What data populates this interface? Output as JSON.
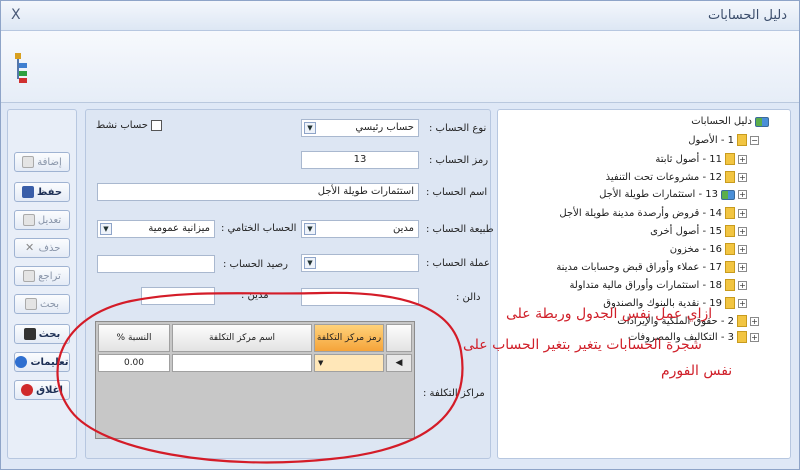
{
  "window": {
    "title": "دليل الحسابات",
    "close": "X"
  },
  "toolbar": {
    "buttons": [
      {
        "label": "إضافة",
        "active": false
      },
      {
        "label": "حفظ",
        "active": true
      },
      {
        "label": "تعديل",
        "active": false
      },
      {
        "label": "حذف",
        "active": false
      },
      {
        "label": "تراجع",
        "active": false
      },
      {
        "label": "بحث",
        "active": false
      },
      {
        "label": "بحث",
        "active": true
      },
      {
        "label": "تعليمات",
        "active": true
      },
      {
        "label": "إغلاق",
        "active": true
      }
    ]
  },
  "form": {
    "active_checkbox_label": "حساب نشط",
    "account_type_label": "نوع الحساب :",
    "account_type_value": "حساب رئيسي",
    "account_code_label": "رمز الحساب :",
    "account_code_value": "13",
    "account_name_label": "اسم الحساب :",
    "account_name_value": "استثمارات طويلة الأجل",
    "account_nature_label": "طبيعة الحساب :",
    "account_nature_value": "مدين",
    "final_account_label": "الحساب الختامي :",
    "final_account_value": "ميزانية عمومية",
    "currency_label": "عملة الحساب :",
    "currency_value": "",
    "balance_label": "رصيد الحساب :",
    "balance_value": "",
    "link_label": "دالن :",
    "link_value": "",
    "debit_label": "مدين :",
    "debit_value": "",
    "cost_centers_label": "مراكز التكلفة :"
  },
  "grid": {
    "headers": [
      "رمز مركز التكلفة",
      "اسم مركز التكلفة",
      "النسبة %"
    ],
    "rows": [
      {
        "code": "",
        "name": "",
        "percent": "0.00"
      }
    ]
  },
  "tree": {
    "root": "دليل الحسابات",
    "level1": "1 - الأصول",
    "items": [
      "11 - أصول ثابتة",
      "12 - مشروعات تحت التنفيذ",
      "13 - استثمارات طويلة الأجل",
      "14 - قروض وأرصدة مدينة طويلة الأجل",
      "15 - أصول أخرى",
      "16 - مخزون",
      "17 - عملاء وأوراق قبض وحسابات مدينة",
      "18 - استثمارات وأوراق مالية متداولة",
      "19 - نقدية بالبنوك والصندوق",
      "2 - حقوق الملكية والإيرادات",
      "3 - التكاليف والمصروفات"
    ]
  },
  "annotation": {
    "line1": "ازاي عمل نفس الجدول وربطة على",
    "line2": "شجرة الحسابات يتغير بتغير الحساب على",
    "line3": "نفس الفورم"
  }
}
